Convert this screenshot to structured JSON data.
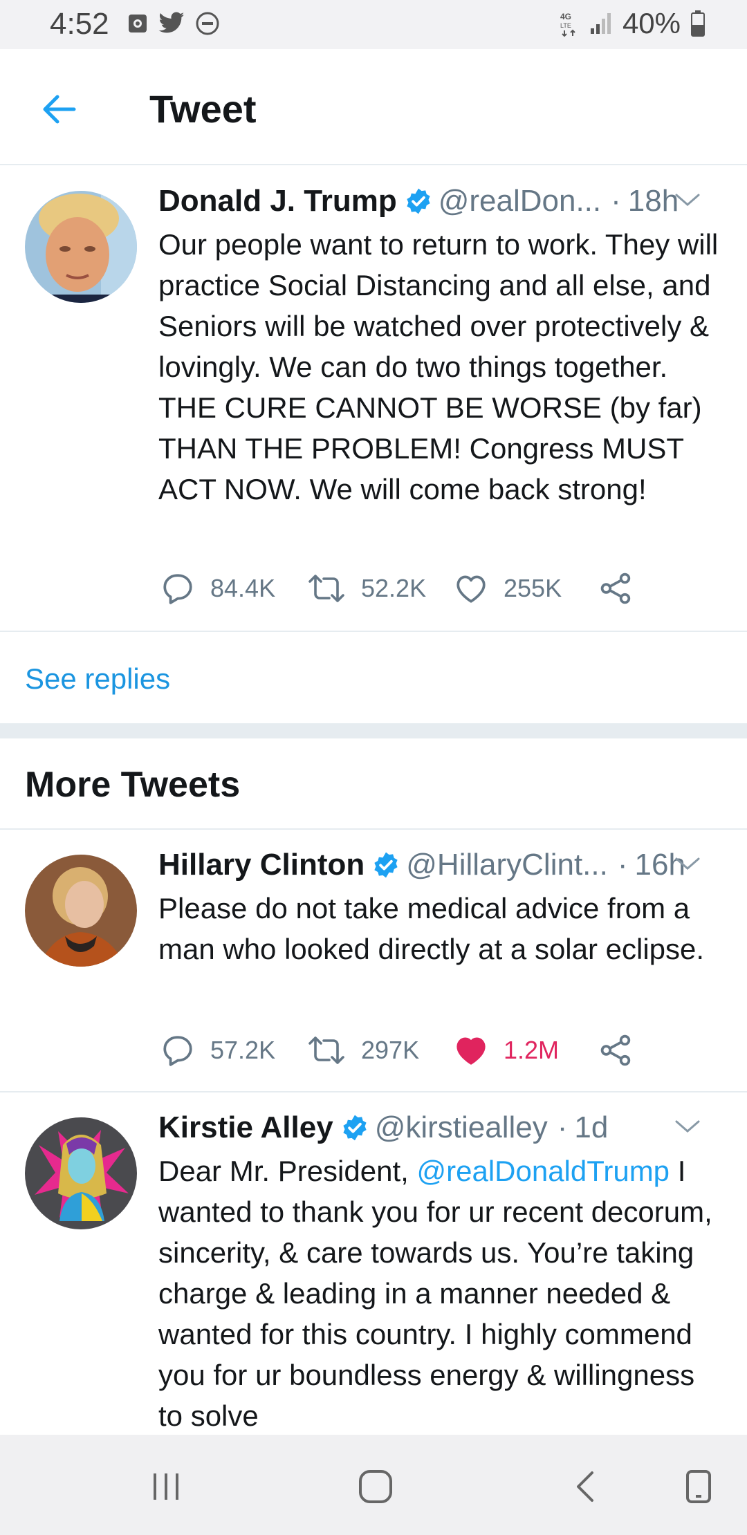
{
  "status_bar": {
    "time": "4:52",
    "battery": "40%",
    "network": "4G LTE"
  },
  "header": {
    "title": "Tweet"
  },
  "main_tweet": {
    "name": "Donald J. Trump",
    "handle": "@realDon...",
    "time": "18h",
    "text": "Our people want to return to work. They will practice Social Distancing and all else, and Seniors will be watched over protectively & lovingly. We can do two things together. THE CURE CANNOT BE WORSE (by far) THAN THE PROBLEM! Congress MUST ACT NOW. We will come back strong!",
    "replies": "84.4K",
    "retweets": "52.2K",
    "likes": "255K"
  },
  "see_replies": "See replies",
  "more_tweets": {
    "title": "More Tweets",
    "items": [
      {
        "name": "Hillary Clinton",
        "handle": "@HillaryClint...",
        "time": "16h",
        "text": "Please do not take medical advice from a man who looked directly at a solar eclipse.",
        "replies": "57.2K",
        "retweets": "297K",
        "likes": "1.2M"
      },
      {
        "name": "Kirstie Alley",
        "handle": "@kirstiealley",
        "time": "1d",
        "text_prefix": "Dear Mr. President,",
        "mention": "@realDonaldTrump",
        "text_rest": "I wanted to thank you for ur recent decorum, sincerity, & care towards us. You’re taking charge & leading in a manner needed & wanted for this country. I highly commend you for ur boundless energy & willingness to solve"
      }
    ]
  },
  "colors": {
    "accent": "#1da1f2",
    "link": "#1b95e0",
    "like": "#e0245e",
    "secondary_text": "#657786"
  },
  "icons": {
    "back": "arrow-left-icon",
    "verified": "verified-badge-icon",
    "reply": "reply-icon",
    "retweet": "retweet-icon",
    "like": "heart-icon",
    "share": "share-icon"
  }
}
